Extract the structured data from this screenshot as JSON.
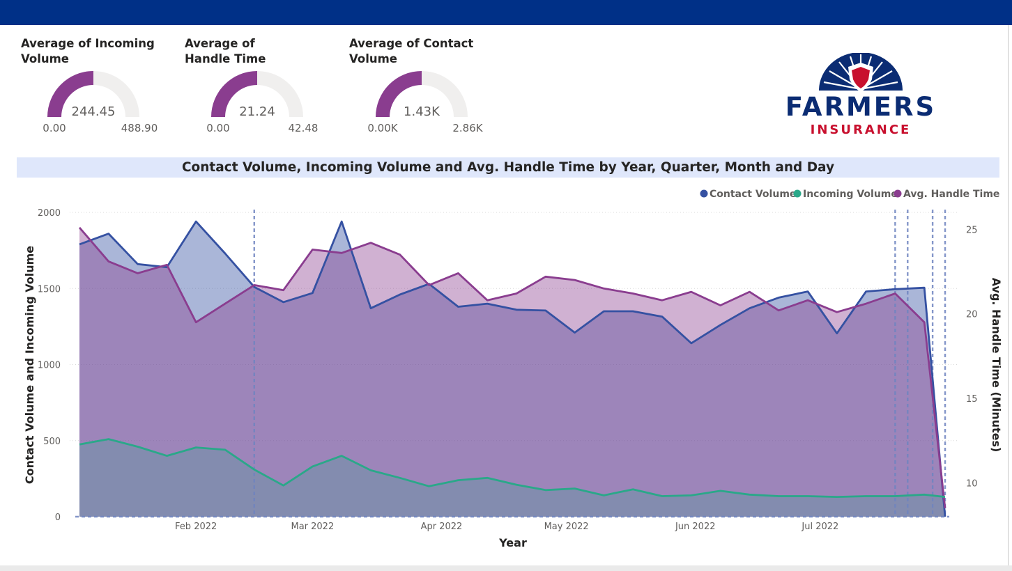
{
  "colors": {
    "header_bar": "#003087",
    "gauge_fill": "#8a3d8f",
    "gauge_track": "#f0efee",
    "contact": "#3551a2",
    "incoming": "#2aa889",
    "handle": "#8a3d8f",
    "title_band": "#dfe7fb"
  },
  "gauges": [
    {
      "title": "Average of Incoming Volume",
      "value_label": "244.45",
      "min_label": "0.00",
      "max_label": "488.90",
      "fraction": 0.5
    },
    {
      "title": "Average of Handle Time",
      "value_label": "21.24",
      "min_label": "0.00",
      "max_label": "42.48",
      "fraction": 0.5
    },
    {
      "title": "Average of Contact Volume",
      "value_label": "1.43K",
      "min_label": "0.00K",
      "max_label": "2.86K",
      "fraction": 0.5
    }
  ],
  "logo": {
    "word1": "FARMERS",
    "word2": "INSURANCE"
  },
  "chart_data": {
    "type": "area",
    "title": "Contact Volume, Incoming Volume and Avg. Handle Time by Year, Quarter, Month and Day",
    "xlabel": "Year",
    "ylabel": "Contact Volume and Incoming Volume",
    "y2label": "Avg. Handle Time (Minutes)",
    "ylim": [
      0,
      2000
    ],
    "yticks": [
      0,
      500,
      1000,
      1500,
      2000
    ],
    "y2lim": [
      8,
      26
    ],
    "y2ticks": [
      10,
      15,
      20,
      25
    ],
    "xlim": [
      "2022-01-03",
      "2022-08-01"
    ],
    "xticks": [
      {
        "date": "2022-02-01",
        "label": "Feb 2022"
      },
      {
        "date": "2022-03-01",
        "label": "Mar 2022"
      },
      {
        "date": "2022-04-01",
        "label": "Apr 2022"
      },
      {
        "date": "2022-05-01",
        "label": "May 2022"
      },
      {
        "date": "2022-06-01",
        "label": "Jun 2022"
      },
      {
        "date": "2022-07-01",
        "label": "Jul 2022"
      }
    ],
    "x": [
      "2022-01-04",
      "2022-01-11",
      "2022-01-18",
      "2022-01-25",
      "2022-02-01",
      "2022-02-08",
      "2022-02-15",
      "2022-02-22",
      "2022-03-01",
      "2022-03-08",
      "2022-03-15",
      "2022-03-22",
      "2022-03-29",
      "2022-04-05",
      "2022-04-12",
      "2022-04-19",
      "2022-04-26",
      "2022-05-03",
      "2022-05-10",
      "2022-05-17",
      "2022-05-24",
      "2022-05-31",
      "2022-06-07",
      "2022-06-14",
      "2022-06-21",
      "2022-06-28",
      "2022-07-05",
      "2022-07-12",
      "2022-07-19",
      "2022-07-26",
      "2022-07-31"
    ],
    "series": [
      {
        "name": "Contact Volume",
        "axis": "left",
        "values": [
          1790,
          1860,
          1660,
          1640,
          1940,
          1730,
          1510,
          1410,
          1470,
          1940,
          1370,
          1460,
          1530,
          1380,
          1400,
          1360,
          1355,
          1210,
          1350,
          1350,
          1315,
          1140,
          1260,
          1370,
          1440,
          1480,
          1205,
          1480,
          1495,
          1505,
          0
        ]
      },
      {
        "name": "Incoming Volume",
        "axis": "left",
        "values": [
          475,
          510,
          460,
          400,
          455,
          440,
          310,
          205,
          330,
          400,
          305,
          255,
          200,
          240,
          255,
          210,
          175,
          185,
          140,
          180,
          135,
          140,
          170,
          145,
          135,
          135,
          130,
          135,
          135,
          145,
          130
        ]
      },
      {
        "name": "Avg. Handle Time",
        "axis": "right",
        "values": [
          25.1,
          23.1,
          22.4,
          22.9,
          19.5,
          20.6,
          21.7,
          21.4,
          23.8,
          23.6,
          24.2,
          23.5,
          21.7,
          22.4,
          20.8,
          21.2,
          22.2,
          22.0,
          21.5,
          21.2,
          20.8,
          21.3,
          20.5,
          21.3,
          20.2,
          20.8,
          20.1,
          20.6,
          21.2,
          19.5,
          8.5
        ]
      }
    ],
    "vertical_reference_dates": [
      "2022-02-15",
      "2022-07-19",
      "2022-07-22",
      "2022-07-28",
      "2022-07-31"
    ],
    "gridlines": true,
    "legend_position": "top-right"
  }
}
